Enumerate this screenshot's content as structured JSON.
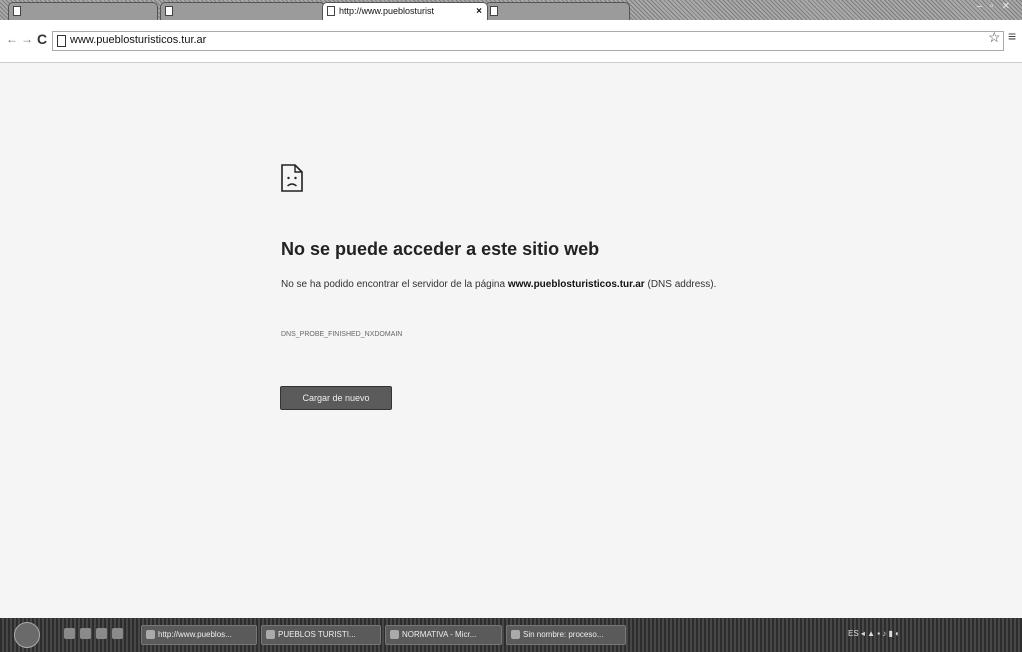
{
  "browser": {
    "tabs": [
      {
        "label": ""
      },
      {
        "label": ""
      },
      {
        "label": "http://www.pueblosturist",
        "close": "×"
      },
      {
        "label": ""
      }
    ],
    "window_user": "",
    "address_bar": {
      "url": "www.pueblosturisticos.tur.ar"
    }
  },
  "error_page": {
    "title": "No se puede acceder a este sitio web",
    "message_prefix": "No se ha podido encontrar el servidor de la página",
    "message_host": "www.pueblosturisticos.tur.ar",
    "message_suffix": "(DNS address).",
    "error_code": "DNS_PROBE_FINISHED_NXDOMAIN",
    "reload_label": "Cargar de nuevo"
  },
  "taskbar": {
    "items": [
      {
        "label": "http://www.pueblos..."
      },
      {
        "label": "PUEBLOS TURISTI..."
      },
      {
        "label": "NORMATIVA - Micr..."
      },
      {
        "label": "Sin nombre: proceso..."
      }
    ]
  },
  "icons": {
    "error": "sad-page-icon",
    "reload": "reload-icon",
    "star": "star-icon",
    "menu": "menu-icon"
  }
}
